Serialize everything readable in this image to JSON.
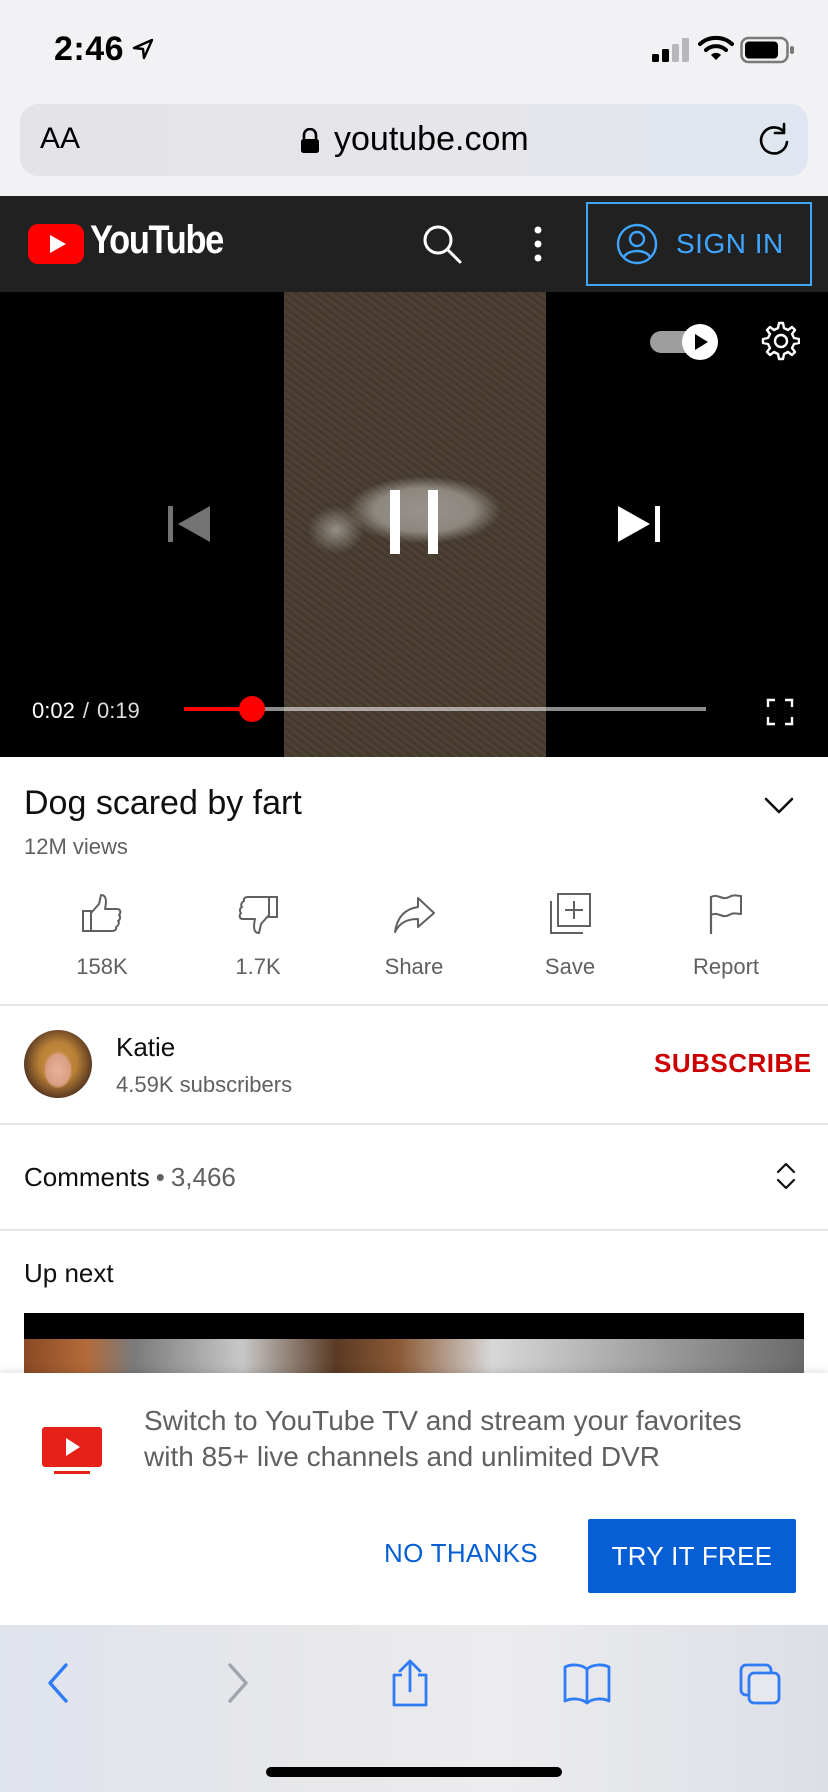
{
  "status_bar": {
    "time": "2:46"
  },
  "browser": {
    "text_size_label": "AA",
    "url": "youtube.com"
  },
  "header": {
    "logo_text": "YouTube",
    "sign_in_label": "SIGN IN"
  },
  "player": {
    "current_time": "0:02",
    "duration": "0:19",
    "separator": "/",
    "progress": 0.13,
    "autoplay": true,
    "state": "playing"
  },
  "video": {
    "title": "Dog scared by fart",
    "views": "12M views"
  },
  "actions": [
    {
      "label": "158K",
      "icon": "thumbs-up-icon"
    },
    {
      "label": "1.7K",
      "icon": "thumbs-down-icon"
    },
    {
      "label": "Share",
      "icon": "share-icon"
    },
    {
      "label": "Save",
      "icon": "save-playlist-icon"
    },
    {
      "label": "Report",
      "icon": "flag-icon"
    }
  ],
  "channel": {
    "name": "Katie",
    "subscribers": "4.59K subscribers",
    "subscribe_label": "SUBSCRIBE"
  },
  "comments": {
    "label": "Comments",
    "separator": "•",
    "count": "3,466"
  },
  "up_next": {
    "label": "Up next"
  },
  "promo": {
    "text": "Switch to YouTube TV and stream your favorites with 85+ live channels and unlimited DVR",
    "dismiss_label": "NO THANKS",
    "cta_label": "TRY IT FREE"
  },
  "colors": {
    "brand_red": "#ff0000",
    "link_blue": "#065fd4",
    "header_bg": "#212121",
    "subscribe_red": "#cc0000",
    "ios_blue": "#2f7cf6"
  }
}
